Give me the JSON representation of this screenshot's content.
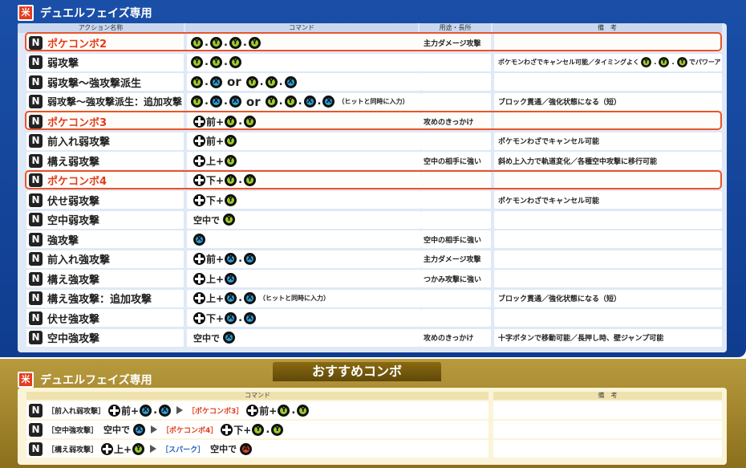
{
  "top_panel": {
    "icon_glyph": "米",
    "title": "デュエルフェイズ専用",
    "col_headers": [
      "アクション名称",
      "コマンド",
      "用途・長所",
      "備　考"
    ]
  },
  "rows": [
    {
      "badge": "N",
      "name": "ポケコンボ2",
      "combo": true,
      "use": "主力ダメージ攻撃",
      "note": ""
    },
    {
      "badge": "N",
      "name": "弱攻撃",
      "combo": false,
      "use": "",
      "note": "ポケモンわざでキャンセル可能／タイミングよく",
      "note_suffix": "でパワーアップ"
    },
    {
      "badge": "N",
      "name": "弱攻撃～強攻撃派生",
      "combo": false,
      "use": "",
      "note": ""
    },
    {
      "badge": "N",
      "name": "弱攻撃～強攻撃派生：追加攻撃",
      "combo": false,
      "use": "",
      "note": "ブロック貫通／強化状態になる（短）"
    },
    {
      "badge": "N",
      "name": "ポケコンボ3",
      "combo": true,
      "use": "攻めのきっかけ",
      "note": ""
    },
    {
      "badge": "N",
      "name": "前入れ弱攻撃",
      "combo": false,
      "use": "",
      "note": "ポケモンわざでキャンセル可能"
    },
    {
      "badge": "N",
      "name": "構え弱攻撃",
      "combo": false,
      "use": "空中の相手に強い",
      "note": "斜め上入力で軌道変化／各種空中攻撃に移行可能"
    },
    {
      "badge": "N",
      "name": "ポケコンボ4",
      "combo": true,
      "use": "",
      "note": ""
    },
    {
      "badge": "N",
      "name": "伏せ弱攻撃",
      "combo": false,
      "use": "",
      "note": "ポケモンわざでキャンセル可能"
    },
    {
      "badge": "N",
      "name": "空中弱攻撃",
      "combo": false,
      "use": "",
      "note": ""
    },
    {
      "badge": "N",
      "name": "強攻撃",
      "combo": false,
      "use": "空中の相手に強い",
      "note": ""
    },
    {
      "badge": "N",
      "name": "前入れ強攻撃",
      "combo": false,
      "use": "主力ダメージ攻撃",
      "note": ""
    },
    {
      "badge": "N",
      "name": "構え強攻撃",
      "combo": false,
      "use": "つかみ攻撃に強い",
      "note": ""
    },
    {
      "badge": "N",
      "name": "構え強攻撃：追加攻撃",
      "combo": false,
      "use": "",
      "note": "ブロック貫通／強化状態になる（短）"
    },
    {
      "badge": "N",
      "name": "伏せ強攻撃",
      "combo": false,
      "use": "",
      "note": ""
    },
    {
      "badge": "N",
      "name": "空中強攻撃",
      "combo": false,
      "use": "攻めのきっかけ",
      "note": "十字ボタンで移動可能／長押し時、壁ジャンプ可能"
    }
  ],
  "cmd_text": {
    "or": "or",
    "fwd": "前+",
    "up": "上+",
    "down": "下+",
    "air": "空中で",
    "hit_simul": "（ヒットと同時に入力）"
  },
  "bottom_panel": {
    "icon_glyph": "米",
    "title": "デュエルフェイズ専用",
    "tab_title": "おすすめコンボ",
    "col_headers": [
      "コマンド",
      "備　考"
    ],
    "combos": [
      {
        "start": "［前入れ弱攻撃］",
        "link": "［ポケコンボ3］"
      },
      {
        "start": "［空中強攻撃］",
        "link": "［ポケコンボ4］"
      },
      {
        "start": "［構え弱攻撃］",
        "link": "［スパーク］"
      }
    ]
  },
  "icons": {
    "y_button": "Y-button-icon-green",
    "x_button": "X-button-icon-blue",
    "a_button": "A-button-icon-red",
    "dpad": "dpad-icon"
  },
  "colors": {
    "blue_panel": "#1a4fa8",
    "gold_panel": "#b89a3e",
    "combo_red": "#e23a1a",
    "y_green": "#9ccc2a",
    "x_blue": "#2a9fd8"
  }
}
